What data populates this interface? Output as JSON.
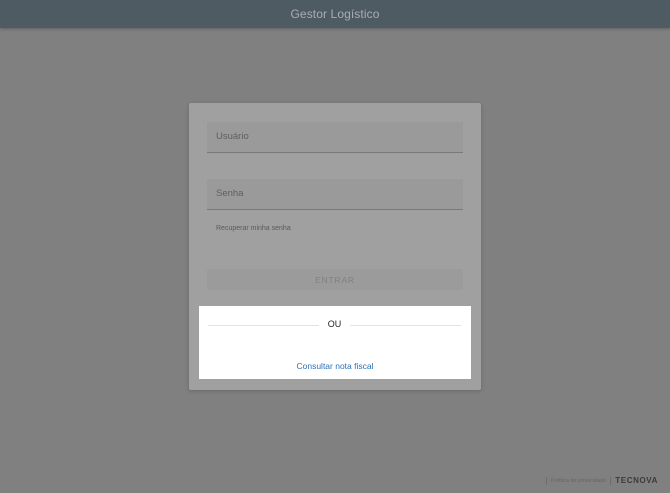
{
  "app": {
    "title": "Gestor Logístico"
  },
  "login": {
    "user_label": "Usuário",
    "password_label": "Senha",
    "recover_link": "Recuperar minha senha",
    "enter_button": "ENTRAR"
  },
  "alternative": {
    "divider_text": "OU",
    "consult_link": "Consultar nota fiscal"
  },
  "footer": {
    "privacy_link": "Política de privacidade",
    "brand": "TECNOVA"
  },
  "colors": {
    "appbar": "#4f5b63",
    "link": "#2a72b5",
    "backdrop": "#808080"
  }
}
